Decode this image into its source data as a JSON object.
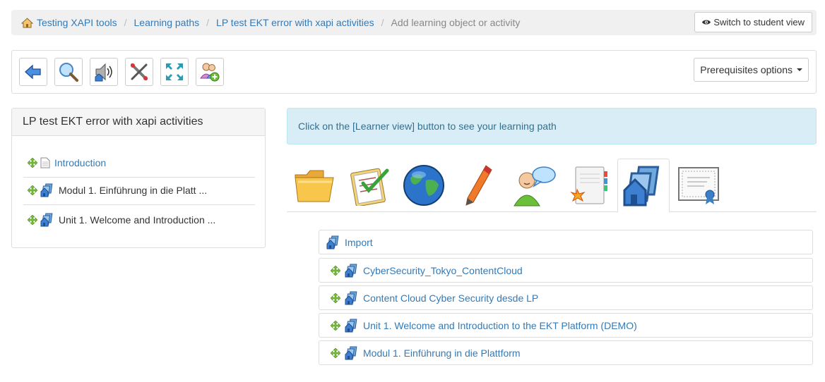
{
  "breadcrumb": {
    "items": [
      "Testing XAPI tools",
      "Learning paths",
      "LP test EKT error with xapi activities"
    ],
    "current": "Add learning object or activity"
  },
  "header": {
    "student_view_label": "Switch to student view"
  },
  "toolbar": {
    "buttons": [
      "back-icon",
      "preview-icon",
      "audio-icon",
      "settings-icon",
      "fullscreen-icon",
      "add-users-icon"
    ],
    "prerequisites_label": "Prerequisites options"
  },
  "left_panel": {
    "title": "LP test EKT error with xapi activities",
    "items": [
      {
        "label": "Introduction",
        "icon": "document-icon"
      },
      {
        "label": "Modul 1. Einführung in die Platt ...",
        "icon": "learning-path-icon"
      },
      {
        "label": "Unit 1. Welcome and Introduction ...",
        "icon": "learning-path-icon"
      }
    ]
  },
  "alert": {
    "text": "Click on the [Learner view] button to see your learning path"
  },
  "tabs": [
    {
      "name": "documents",
      "icon": "folder-icon"
    },
    {
      "name": "tests",
      "icon": "checklist-icon"
    },
    {
      "name": "links",
      "icon": "globe-icon"
    },
    {
      "name": "assignments",
      "icon": "pen-icon"
    },
    {
      "name": "forums",
      "icon": "chat-user-icon"
    },
    {
      "name": "certificates-notes",
      "icon": "notebook-icon"
    },
    {
      "name": "learning-paths",
      "icon": "learning-path-icon",
      "active": true
    },
    {
      "name": "certificate",
      "icon": "certificate-icon"
    }
  ],
  "resources": {
    "import_label": "Import",
    "items": [
      "CyberSecurity_Tokyo_ContentCloud",
      "Content Cloud Cyber Security desde LP",
      "Unit 1. Welcome and Introduction to the EKT Platform (DEMO)",
      "Modul 1. Einführung in die Plattform"
    ]
  },
  "colors": {
    "link": "#337ab7",
    "alert_bg": "#d9edf7",
    "alert_text": "#31708f",
    "breadcrumb_bg": "#f0f0f0"
  }
}
